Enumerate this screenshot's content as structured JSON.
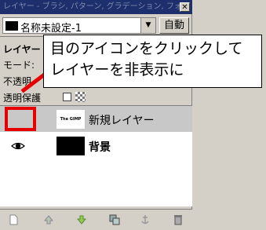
{
  "titlebar": {
    "title": "レイヤー - ブラシ, パターン, グラデーション, フォン"
  },
  "image_selector": {
    "value": "名称未設定-1"
  },
  "auto_button": {
    "label": "自動"
  },
  "panel": {
    "layer_label": "レイヤー",
    "mode_label": "モード:",
    "opacity_label": "不透明",
    "lock_label": "透明保護"
  },
  "layers": [
    {
      "name": "新規レイヤー",
      "thumb_text": "The GIMP",
      "visible": false,
      "selected": true
    },
    {
      "name": "背景",
      "visible": true,
      "selected": false
    }
  ],
  "callout": {
    "line1": "目のアイコンをクリックして",
    "line2": "レイヤーを非表示に"
  },
  "colors": {
    "highlight": "#e60000",
    "titlebar": "#1e2f6e",
    "selected_row": "#c8c8c8"
  },
  "bottom_icons": [
    "new-layer-icon",
    "raise-layer-icon",
    "lower-layer-icon",
    "duplicate-layer-icon",
    "anchor-layer-icon",
    "delete-layer-icon"
  ]
}
